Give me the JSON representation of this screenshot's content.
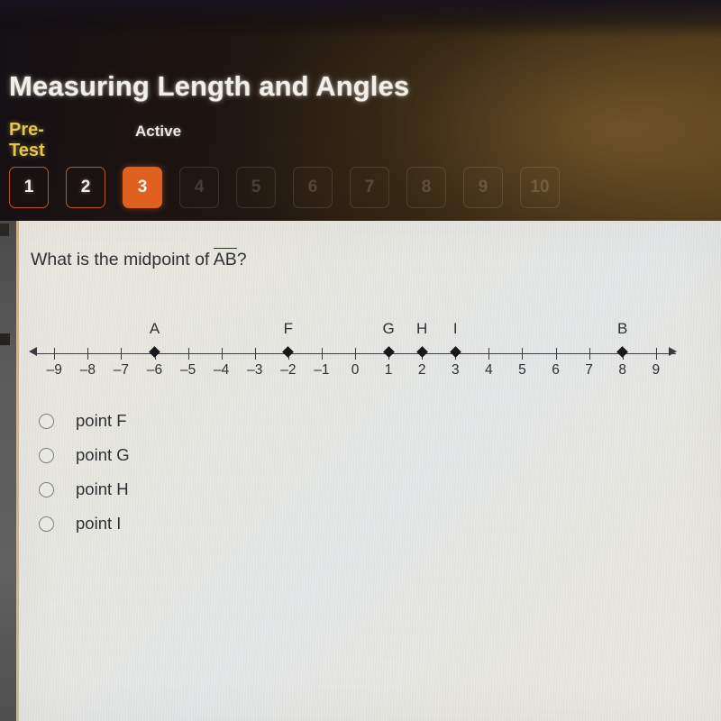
{
  "header": {
    "title": "Measuring Length and Angles",
    "lesson_type": "Pre-Test",
    "status": "Active",
    "accent_color": "#df601f",
    "lesson_type_color": "#e4c64b"
  },
  "question_nav": {
    "tabs": [
      {
        "label": "1",
        "state": "done"
      },
      {
        "label": "2",
        "state": "done"
      },
      {
        "label": "3",
        "state": "current"
      },
      {
        "label": "4",
        "state": "future"
      },
      {
        "label": "5",
        "state": "future"
      },
      {
        "label": "6",
        "state": "future"
      },
      {
        "label": "7",
        "state": "future"
      },
      {
        "label": "8",
        "state": "future"
      },
      {
        "label": "9",
        "state": "future"
      },
      {
        "label": "10",
        "state": "future"
      }
    ]
  },
  "question": {
    "text_before": "What is the midpoint of ",
    "segment": "AB",
    "text_after": "?"
  },
  "chart_data": {
    "type": "numberline",
    "title": "",
    "xlabel": "",
    "xlim": [
      -9.6,
      9.6
    ],
    "tick_values": [
      -9,
      -8,
      -7,
      -6,
      -5,
      -4,
      -3,
      -2,
      -1,
      0,
      1,
      2,
      3,
      4,
      5,
      6,
      7,
      8,
      9
    ],
    "tick_labels": [
      "–9",
      "–8",
      "–7",
      "–6",
      "–5",
      "–4",
      "–3",
      "–2",
      "–1",
      "0",
      "1",
      "2",
      "3",
      "4",
      "5",
      "6",
      "7",
      "8",
      "9"
    ],
    "points": [
      {
        "label": "A",
        "value": -6
      },
      {
        "label": "F",
        "value": -2
      },
      {
        "label": "G",
        "value": 1
      },
      {
        "label": "H",
        "value": 2
      },
      {
        "label": "I",
        "value": 3
      },
      {
        "label": "B",
        "value": 8
      }
    ],
    "arrows_both_ends": true,
    "grid": false,
    "legend": "none"
  },
  "choices": [
    {
      "label": "point F",
      "selected": false
    },
    {
      "label": "point G",
      "selected": false
    },
    {
      "label": "point H",
      "selected": false
    },
    {
      "label": "point I",
      "selected": false
    }
  ]
}
